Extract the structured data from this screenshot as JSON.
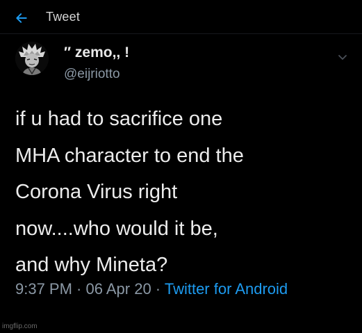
{
  "header": {
    "back_icon": "arrow-left-icon",
    "title": "Tweet"
  },
  "author": {
    "display_name": "″ zemo,, !",
    "username": "@eijriotto",
    "avatar_icon": "anime-character-avatar"
  },
  "menu_icon": "chevron-down-icon",
  "tweet": {
    "text": "if u had to sacrifice one\nMHA character to end the\nCorona Virus right\nnow....who would it be,\nand why Mineta?",
    "time": "9:37 PM",
    "separator": " · ",
    "date": "06 Apr 20",
    "source": "Twitter for Android"
  },
  "watermark": "imgflip.com",
  "colors": {
    "background": "#000000",
    "primary_text": "#e7e9ea",
    "secondary_text": "#8b98a5",
    "accent": "#1d9bf0"
  }
}
